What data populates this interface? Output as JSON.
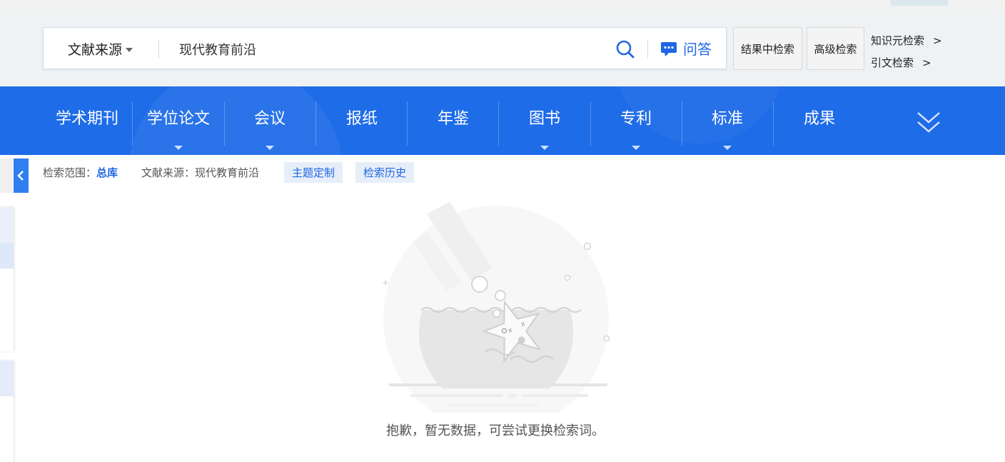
{
  "search": {
    "source_label": "文献来源",
    "query": "现代教育前沿",
    "qa_label": "问答"
  },
  "actions": {
    "search_within": "结果中检索",
    "advanced": "高级检索",
    "knowledge_search": "知识元检索",
    "citation_search": "引文检索",
    "chevron": ">"
  },
  "nav": {
    "items": [
      {
        "label": "学术期刊"
      },
      {
        "label": "学位论文"
      },
      {
        "label": "会议"
      },
      {
        "label": "报纸"
      },
      {
        "label": "年鉴"
      },
      {
        "label": "图书"
      },
      {
        "label": "专利"
      },
      {
        "label": "标准"
      },
      {
        "label": "成果"
      }
    ]
  },
  "scope": {
    "range_label": "检索范围：",
    "range_value": "总库",
    "source_label": "文献来源：",
    "source_value": "现代教育前沿",
    "topic_custom": "主题定制",
    "history": "检索历史"
  },
  "empty": {
    "message": "抱歉，暂无数据，可尝试更换检索词。"
  },
  "colors": {
    "nav_blue": "#1f6ce8",
    "link_blue": "#1f66e5",
    "tag_bg": "#e6eef9"
  }
}
